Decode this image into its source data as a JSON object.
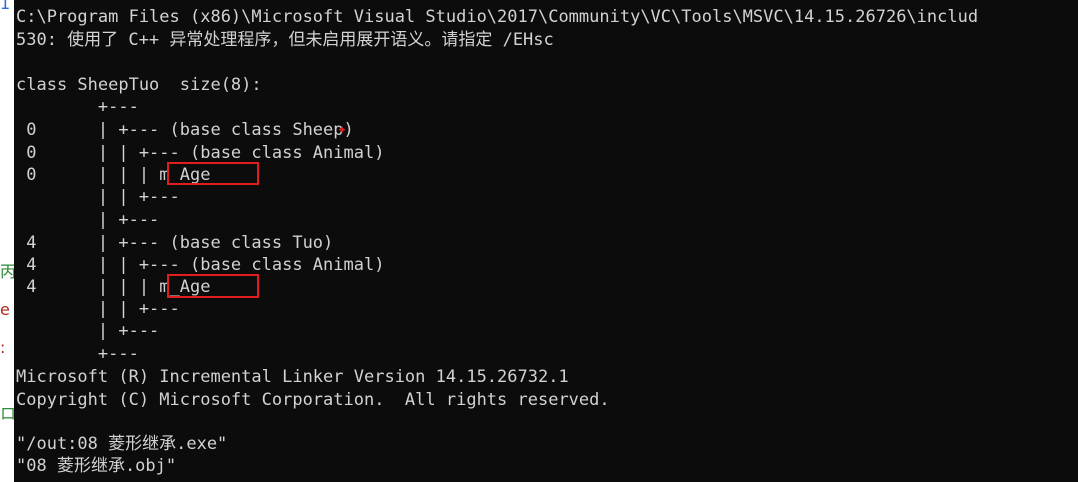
{
  "console": {
    "lines": [
      "C:\\Program Files (x86)\\Microsoft Visual Studio\\2017\\Community\\VC\\Tools\\MSVC\\14.15.26726\\includ",
      "530: 使用了 C++ 异常处理程序，但未启用展开语义。请指定 /EHsc",
      "",
      "class SheepTuo  size(8):",
      "        +---",
      " 0      | +--- (base class Sheep)",
      " 0      | | +--- (base class Animal)",
      " 0      | | | m_Age",
      "        | | +---",
      "        | +---",
      " 4      | +--- (base class Tuo)",
      " 4      | | +--- (base class Animal)",
      " 4      | | | m_Age",
      "        | | +---",
      "        | +---",
      "        +---",
      "Microsoft (R) Incremental Linker Version 14.15.26732.1",
      "Copyright (C) Microsoft Corporation.  All rights reserved.",
      "",
      "\"/out:08 菱形继承.exe\"",
      "\"08 菱形继承.obj\""
    ]
  },
  "side_glyphs": [
    "1",
    "丙",
    "e",
    ":",
    "ロ"
  ],
  "colors": {
    "background": "#0c0c0c",
    "text": "#d2d2d2",
    "highlight": "#e01e1e"
  }
}
